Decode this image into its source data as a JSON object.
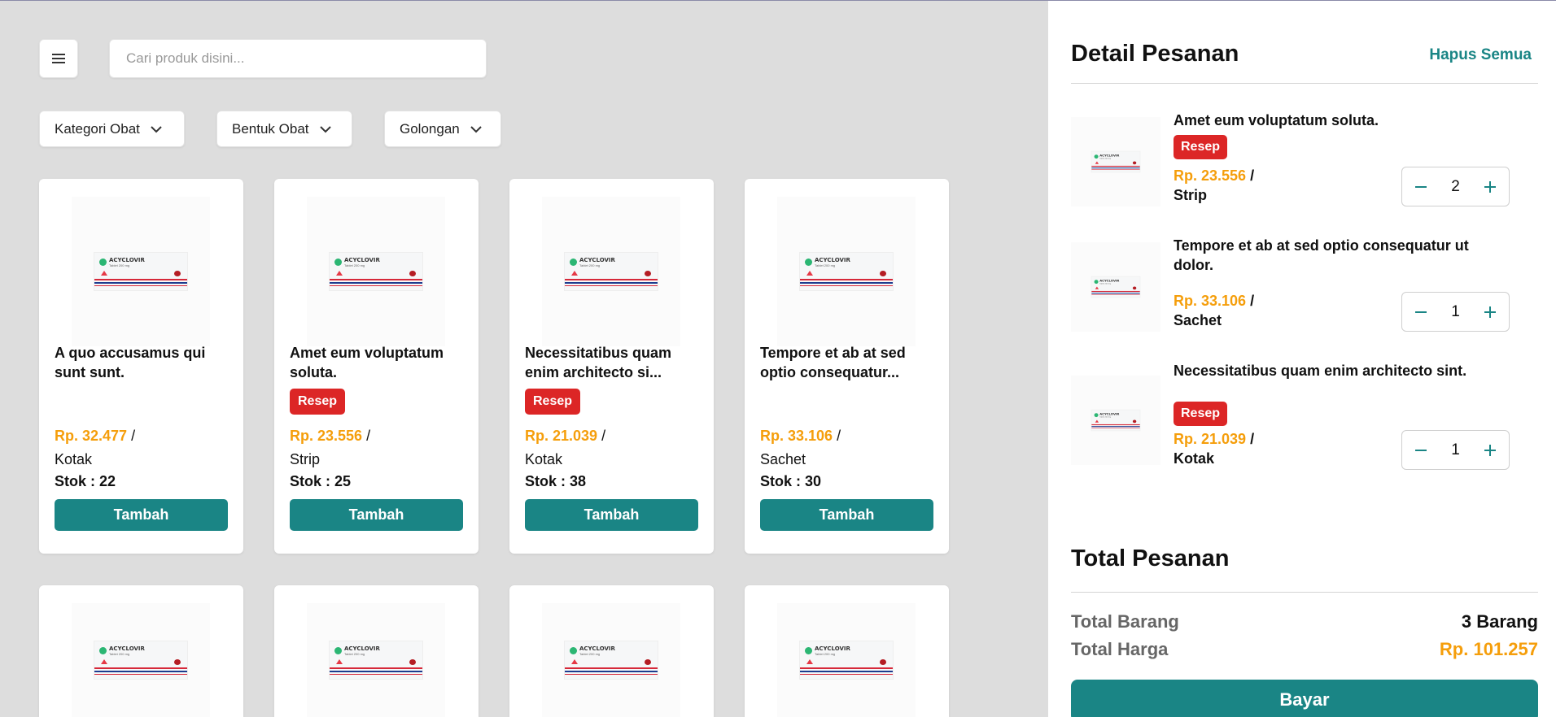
{
  "search": {
    "placeholder": "Cari produk disini..."
  },
  "icons": {
    "menu": "hamburger-icon",
    "dropdown": "chevron-down-icon",
    "minus": "minus-icon",
    "plus": "plus-icon"
  },
  "filters": [
    {
      "label": "Kategori Obat"
    },
    {
      "label": "Bentuk Obat"
    },
    {
      "label": "Golongan"
    }
  ],
  "product_image": {
    "brand": "ACYCLOVIR",
    "sub": "Tablet 200 mg"
  },
  "products": [
    {
      "name": "A quo accusamus qui sunt sunt.",
      "badge": "",
      "price": "Rp. 32.477",
      "sep": " /",
      "unit": "Kotak",
      "stock": "Stok : 22",
      "button": "Tambah"
    },
    {
      "name": "Amet eum voluptatum soluta.",
      "badge": "Resep",
      "price": "Rp. 23.556",
      "sep": " /",
      "unit": "Strip",
      "stock": "Stok : 25",
      "button": "Tambah"
    },
    {
      "name": "Necessitatibus quam enim architecto si...",
      "badge": "Resep",
      "price": "Rp. 21.039",
      "sep": " /",
      "unit": "Kotak",
      "stock": "Stok : 38",
      "button": "Tambah"
    },
    {
      "name": "Tempore et ab at sed optio consequatur...",
      "badge": "",
      "price": "Rp. 33.106",
      "sep": " /",
      "unit": "Sachet",
      "stock": "Stok : 30",
      "button": "Tambah"
    }
  ],
  "order": {
    "title": "Detail Pesanan",
    "clear_all": "Hapus Semua",
    "items": [
      {
        "name": "Amet eum voluptatum soluta.",
        "badge": "Resep",
        "price": "Rp. 23.556",
        "sep": " /",
        "unit": "Strip",
        "qty": "2"
      },
      {
        "name": "Tempore et ab at sed optio consequatur ut dolor.",
        "badge": "",
        "price": "Rp. 33.106",
        "sep": " /",
        "unit": "Sachet",
        "qty": "1"
      },
      {
        "name": "Necessitatibus quam enim architecto sint.",
        "badge": "Resep",
        "price": "Rp. 21.039",
        "sep": " /",
        "unit": "Kotak",
        "qty": "1"
      }
    ]
  },
  "summary": {
    "title": "Total Pesanan",
    "items_label": "Total Barang",
    "items_value": "3 Barang",
    "price_label": "Total Harga",
    "price_value": "Rp. 101.257",
    "pay_button": "Bayar"
  },
  "colors": {
    "teal": "#1a8585",
    "orange": "#f59e0b",
    "red": "#dc2626"
  }
}
